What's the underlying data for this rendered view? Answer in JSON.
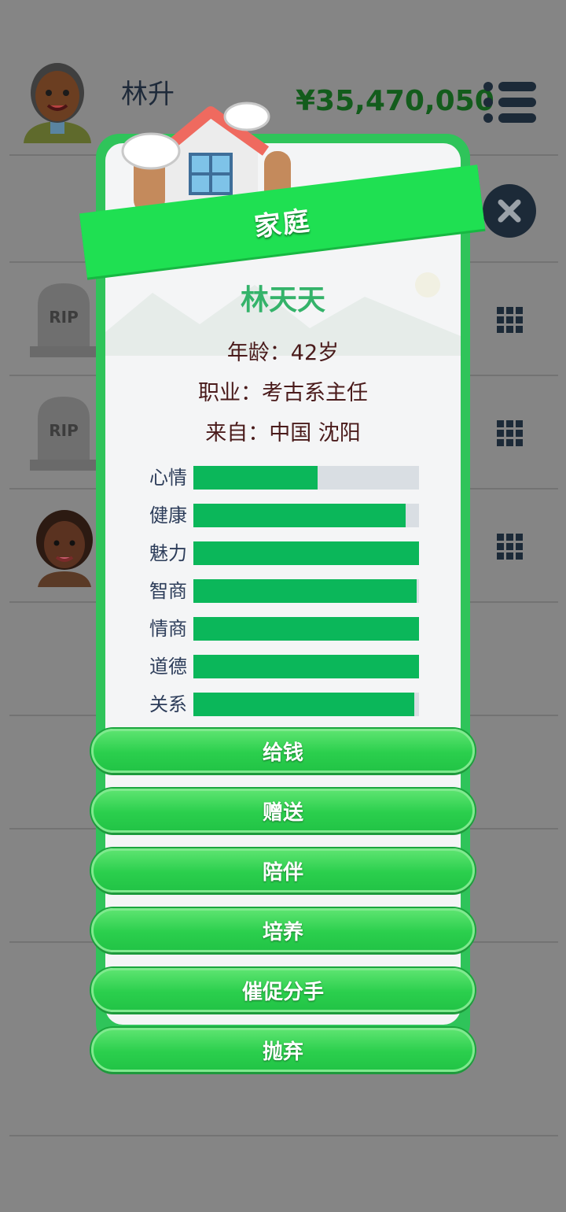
{
  "header": {
    "player_name": "林升",
    "money": "¥35,470,050"
  },
  "modal": {
    "title": "家庭",
    "person": {
      "name": "林天天",
      "age_line": "年龄：42岁",
      "job_line": "职业：考古系主任",
      "from_line": "来自：中国 沈阳"
    },
    "stats": [
      {
        "label": "心情",
        "value": 0.55
      },
      {
        "label": "健康",
        "value": 0.94
      },
      {
        "label": "魅力",
        "value": 1.0
      },
      {
        "label": "智商",
        "value": 0.99
      },
      {
        "label": "情商",
        "value": 1.0
      },
      {
        "label": "道德",
        "value": 1.0
      },
      {
        "label": "关系",
        "value": 0.98
      }
    ],
    "actions": [
      "给钱",
      "赠送",
      "陪伴",
      "培养",
      "催促分手",
      "抛弃"
    ]
  },
  "background_list": {
    "tomb_text": "RIP"
  },
  "colors": {
    "accent_green": "#1fe052",
    "stat_fill": "#0bb75a",
    "money": "#135c1c"
  },
  "icons": [
    "menu-icon",
    "close-icon",
    "grid-icon",
    "house-icon"
  ]
}
